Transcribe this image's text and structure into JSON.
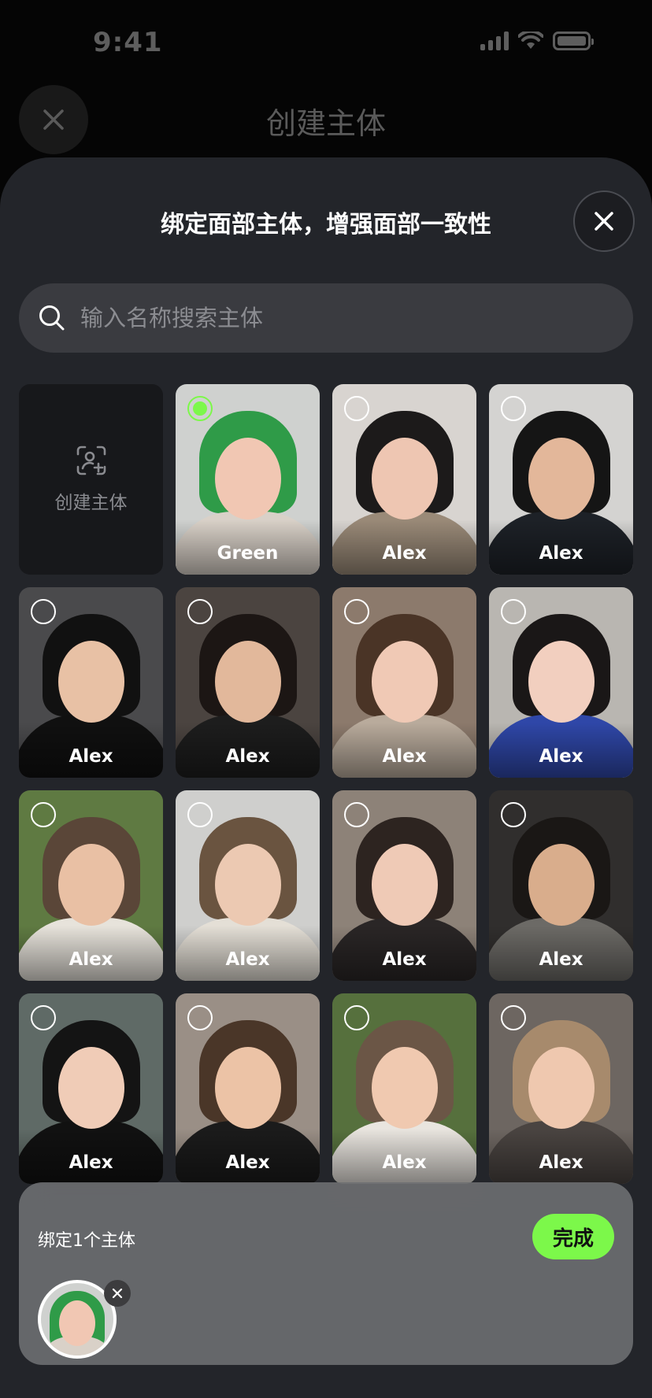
{
  "status_bar": {
    "time": "9:41"
  },
  "page": {
    "title": "创建主体"
  },
  "sheet": {
    "title": "绑定面部主体，增强面部一致性",
    "search": {
      "placeholder": "输入名称搜索主体"
    },
    "create_tile": {
      "label": "创建主体"
    },
    "subjects": [
      {
        "name": "Green",
        "selected": true,
        "bg": "#cfd1cf",
        "hair": "#2f9b48",
        "skin": "#f1c7b3",
        "top": "#d9d1c8"
      },
      {
        "name": "Alex",
        "selected": false,
        "bg": "#d8d4d0",
        "hair": "#1c1a1a",
        "skin": "#eec6b2",
        "top": "#9a8a78"
      },
      {
        "name": "Alex",
        "selected": false,
        "bg": "#d4d3d1",
        "hair": "#151515",
        "skin": "#e3b79a",
        "top": "#1d2127"
      },
      {
        "name": "Alex",
        "selected": false,
        "bg": "#4a4a4c",
        "hair": "#111111",
        "skin": "#e8c1a5",
        "top": "#101010"
      },
      {
        "name": "Alex",
        "selected": false,
        "bg": "#4b4440",
        "hair": "#1c1614",
        "skin": "#e2b89b",
        "top": "#1d1d1d"
      },
      {
        "name": "Alex",
        "selected": false,
        "bg": "#8c7a6c",
        "hair": "#4a3426",
        "skin": "#f0c9b5",
        "top": "#b9ab9c"
      },
      {
        "name": "Alex",
        "selected": false,
        "bg": "#b9b6b1",
        "hair": "#1a1717",
        "skin": "#f2cfbf",
        "top": "#2f47a8"
      },
      {
        "name": "Alex",
        "selected": false,
        "bg": "#5f7a42",
        "hair": "#5a4638",
        "skin": "#e9c0a4",
        "top": "#e7e3db"
      },
      {
        "name": "Alex",
        "selected": false,
        "bg": "#cfcfcd",
        "hair": "#6a5440",
        "skin": "#ecc9b2",
        "top": "#e4dfd6"
      },
      {
        "name": "Alex",
        "selected": false,
        "bg": "#8d8278",
        "hair": "#2d2420",
        "skin": "#efcab6",
        "top": "#2a2626"
      },
      {
        "name": "Alex",
        "selected": false,
        "bg": "#302e2d",
        "hair": "#1a1715",
        "skin": "#d9ad8c",
        "top": "#6c6a66"
      },
      {
        "name": "Alex",
        "selected": false,
        "bg": "#5f6a66",
        "hair": "#141414",
        "skin": "#f0ccb7",
        "top": "#111111"
      },
      {
        "name": "Alex",
        "selected": false,
        "bg": "#9a8f86",
        "hair": "#4a3628",
        "skin": "#ecc3a6",
        "top": "#1b1b1b"
      },
      {
        "name": "Alex",
        "selected": false,
        "bg": "#56703d",
        "hair": "#6b5646",
        "skin": "#f0c9b0",
        "top": "#e9e5df"
      },
      {
        "name": "Alex",
        "selected": false,
        "bg": "#6d6661",
        "hair": "#a78a6c",
        "skin": "#efc8af",
        "top": "#4a4441"
      }
    ]
  },
  "bind_panel": {
    "label": "绑定1个主体",
    "done_label": "完成"
  },
  "colors": {
    "accent": "#7cf84a",
    "sheet_bg": "#23252a",
    "search_bg": "#3a3b40"
  }
}
